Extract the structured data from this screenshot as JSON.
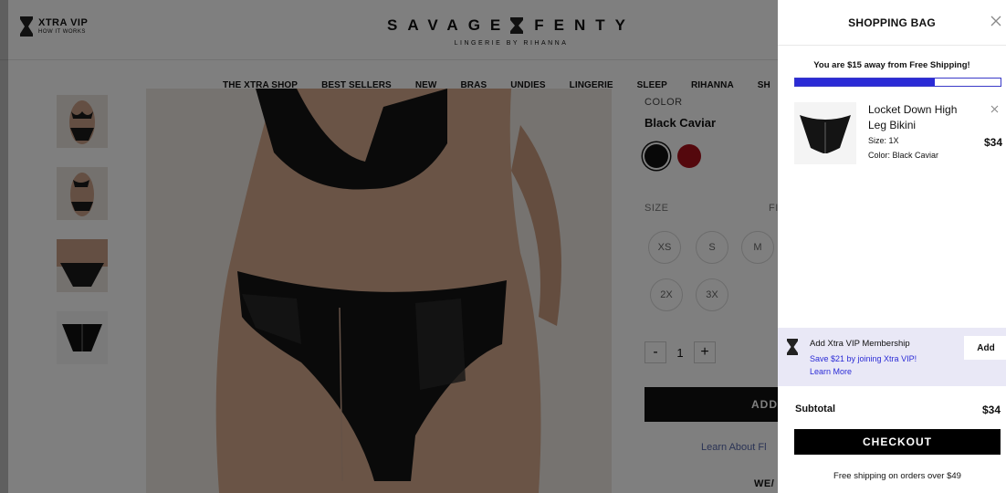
{
  "header": {
    "vip_title": "XTRA VIP",
    "vip_subtitle": "HOW IT WORKS",
    "brand_left": "SAVAGE",
    "brand_right": "FENTY",
    "brand_tagline": "LINGERIE BY RIHANNA"
  },
  "nav": {
    "items": [
      "THE XTRA SHOP",
      "BEST SELLERS",
      "NEW",
      "BRAS",
      "UNDIES",
      "LINGERIE",
      "SLEEP",
      "RIHANNA",
      "SH"
    ]
  },
  "product": {
    "color_label": "COLOR",
    "color_value": "Black Caviar",
    "size_label": "SIZE",
    "fit_label": "FI",
    "sizes": [
      "XS",
      "S",
      "M",
      "2X",
      "3X"
    ],
    "quantity": "1",
    "qty_minus": "-",
    "qty_plus": "+",
    "add_button": "ADD",
    "learn_about": "Learn About Fl",
    "wear_label": "WE/"
  },
  "cart": {
    "title": "SHOPPING BAG",
    "shipping_message": "You are $15 away from Free Shipping!",
    "shipping_progress": 0.68,
    "item": {
      "name": "Locket Down High Leg Bikini",
      "size": "Size: 1X",
      "color": "Color: Black Caviar",
      "price": "$34"
    },
    "vip": {
      "title": "Add Xtra VIP Membership",
      "save": "Save $21 by joining Xtra VIP!",
      "learn_more": "Learn More",
      "add": "Add"
    },
    "subtotal_label": "Subtotal",
    "subtotal_value": "$34",
    "checkout": "CHECKOUT",
    "free_shipping_note": "Free shipping on orders over $49"
  },
  "colors": {
    "accent": "#2b2bd6",
    "vip_bg": "#e9e8f6",
    "swatch_black": "#111111",
    "swatch_red": "#a8101a"
  }
}
